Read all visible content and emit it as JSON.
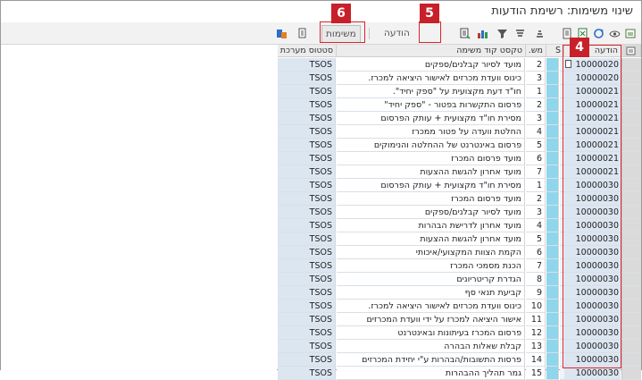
{
  "window": {
    "title": "שינוי משימות: רשימת הודעות"
  },
  "toolbar": {
    "notification_label": "הודעה",
    "tasks_label": "משימות",
    "icons": [
      "refresh-icon",
      "eye-icon",
      "recycle-icon",
      "excel-icon",
      "document-icon",
      "sort-ascending-icon",
      "sort-descending-icon",
      "filter-icon",
      "chart-icon",
      "export-icon",
      "print-preview-icon",
      "layout-icon"
    ]
  },
  "callouts": {
    "c4": "4",
    "c5": "5",
    "c6": "6"
  },
  "columns": {
    "notification": "הודעה",
    "s": "S",
    "num": "מש.",
    "task_text": "טקסט קוד משימה",
    "status": "סטטוס מערכת"
  },
  "rows": [
    {
      "notif": "10000020",
      "num": "2",
      "text": "מועד לסיור קבלנים/ספקים",
      "status": "TSOS",
      "doc": true
    },
    {
      "notif": "10000020",
      "num": "3",
      "text": "כינוס וועדת מכרזים לאישור היציאה למכרז.",
      "status": "TSOS",
      "doc": false
    },
    {
      "notif": "10000021",
      "num": "1",
      "text": "חו\"ד דעת מקצועית על \"ספק יחיד\".",
      "status": "TSOS",
      "doc": false
    },
    {
      "notif": "10000021",
      "num": "2",
      "text": "פרסום התקשרות בפטור - \"ספק יחיד\"",
      "status": "TSOS",
      "doc": false
    },
    {
      "notif": "10000021",
      "num": "3",
      "text": "מסירת חו\"ד מקצועית + עותק הפרסום",
      "status": "TSOS",
      "doc": false
    },
    {
      "notif": "10000021",
      "num": "4",
      "text": "החלטת וועדה על פטור ממכרז",
      "status": "TSOS",
      "doc": false
    },
    {
      "notif": "10000021",
      "num": "5",
      "text": "פרסום באינטרנט של ההחלטה והנימוקים",
      "status": "TSOS",
      "doc": false
    },
    {
      "notif": "10000021",
      "num": "6",
      "text": "מועד פרסום המכרז",
      "status": "TSOS",
      "doc": false
    },
    {
      "notif": "10000021",
      "num": "7",
      "text": "מועד אחרון להגשת ההצעות",
      "status": "TSOS",
      "doc": false
    },
    {
      "notif": "10000030",
      "num": "1",
      "text": "מסירת חו\"ד מקצועית + עותק הפרסום",
      "status": "TSOS",
      "doc": false
    },
    {
      "notif": "10000030",
      "num": "2",
      "text": "מועד פרסום המכרז",
      "status": "TSOS",
      "doc": false
    },
    {
      "notif": "10000030",
      "num": "3",
      "text": "מועד לסיור קבלנים/ספקים",
      "status": "TSOS",
      "doc": false
    },
    {
      "notif": "10000030",
      "num": "4",
      "text": "מועד אחרון לדרישת הבהרות",
      "status": "TSOS",
      "doc": false
    },
    {
      "notif": "10000030",
      "num": "5",
      "text": "מועד אחרון להגשת ההצעות",
      "status": "TSOS",
      "doc": false
    },
    {
      "notif": "10000030",
      "num": "6",
      "text": "הקמת הצוות המקצועי/איכותי",
      "status": "TSOS",
      "doc": false
    },
    {
      "notif": "10000030",
      "num": "7",
      "text": "הכנת מסמכי המכרז",
      "status": "TSOS",
      "doc": false
    },
    {
      "notif": "10000030",
      "num": "8",
      "text": "הגדרת קריטריונים",
      "status": "TSOS",
      "doc": false
    },
    {
      "notif": "10000030",
      "num": "9",
      "text": "קביעת תנאי סף",
      "status": "TSOS",
      "doc": false
    },
    {
      "notif": "10000030",
      "num": "10",
      "text": "כינוס וועדת מכרזים לאישור היציאה למכרז.",
      "status": "TSOS",
      "doc": false
    },
    {
      "notif": "10000030",
      "num": "11",
      "text": "אישור היציאה למכרז על ידי וועדת המכרזים",
      "status": "TSOS",
      "doc": false
    },
    {
      "notif": "10000030",
      "num": "12",
      "text": "פרסום המכרז בעיתונות ובאינטרנט",
      "status": "TSOS",
      "doc": false
    },
    {
      "notif": "10000030",
      "num": "13",
      "text": "קבלת שאלות הבהרה",
      "status": "TSOS",
      "doc": false
    },
    {
      "notif": "10000030",
      "num": "14",
      "text": "פרסות התשובות/הבהרות ע\"י יחידת המכרזים",
      "status": "TSOS",
      "doc": false
    },
    {
      "notif": "10000030",
      "num": "15",
      "text": "גמר תהליך ההבהרות",
      "status": "TSOS",
      "doc": false
    }
  ],
  "colors": {
    "highlight_red": "#d7262e",
    "s_column": "#8fd6ec",
    "light_blue": "#dce6f1"
  }
}
